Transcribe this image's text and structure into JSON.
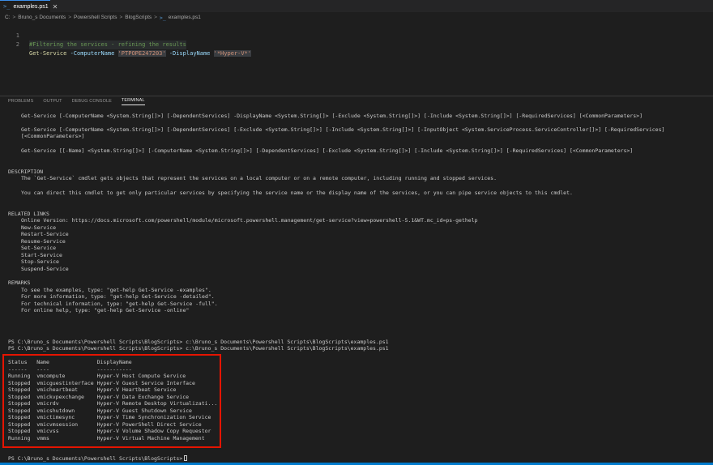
{
  "tab": {
    "icon": "powershell-icon",
    "title": "examples.ps1",
    "close": "✕"
  },
  "breadcrumb": {
    "items": [
      "C:",
      "Bruno_s Documents",
      "Powershell Scripts",
      "BlogScripts"
    ],
    "separator": ">",
    "file_icon": "powershell-icon",
    "file": "examples.ps1"
  },
  "editor": {
    "lines": [
      {
        "num": "1",
        "text": "#Filtering the services - refining the results"
      },
      {
        "num": "2",
        "cmdlet": "Get-Service",
        "param1": "-ComputerName",
        "value1": "'PTPOPE247203'",
        "param2": "-DisplayName",
        "value2": "'*Hyper-V*'"
      }
    ]
  },
  "panel": {
    "tabs": [
      "PROBLEMS",
      "OUTPUT",
      "DEBUG CONSOLE",
      "TERMINAL"
    ],
    "active": "TERMINAL"
  },
  "terminal": {
    "syntax1": "Get-Service [-ComputerName <System.String[]>] [-DependentServices] -DisplayName <System.String[]> [-Exclude <System.String[]>] [-Include <System.String[]>] [-RequiredServices] [<CommonParameters>]",
    "syntax2a": "Get-Service [-ComputerName <System.String[]>] [-DependentServices] [-Exclude <System.String[]>] [-Include <System.String[]>] [-InputObject <System.ServiceProcess.ServiceController[]>] [-RequiredServices]",
    "syntax2b": "[<CommonParameters>]",
    "syntax3": "Get-Service [[-Name] <System.String[]>] [-ComputerName <System.String[]>] [-DependentServices] [-Exclude <System.String[]>] [-Include <System.String[]>] [-RequiredServices] [<CommonParameters>]",
    "description_header": "DESCRIPTION",
    "description1": "The `Get-Service` cmdlet gets objects that represent the services on a local computer or on a remote computer, including running and stopped services.",
    "description2": "You can direct this cmdlet to get only particular services by specifying the service name or the display name of the services, or you can pipe service objects to this cmdlet.",
    "related_header": "RELATED LINKS",
    "related": [
      "Online Version: https://docs.microsoft.com/powershell/module/microsoft.powershell.management/get-service?view=powershell-5.1&WT.mc_id=ps-gethelp",
      "New-Service",
      "Restart-Service",
      "Resume-Service",
      "Set-Service",
      "Start-Service",
      "Stop-Service",
      "Suspend-Service"
    ],
    "remarks_header": "REMARKS",
    "remarks": [
      "To see the examples, type: \"get-help Get-Service -examples\".",
      "For more information, type: \"get-help Get-Service -detailed\".",
      "For technical information, type: \"get-help Get-Service -full\".",
      "For online help, type: \"get-help Get-Service -online\""
    ],
    "prompt_lines": [
      "PS C:\\Bruno_s Documents\\Powershell Scripts\\BlogScripts> c:\\Bruno_s Documents\\Powershell Scripts\\BlogScripts\\examples.ps1",
      "PS C:\\Bruno_s Documents\\Powershell Scripts\\BlogScripts> c:\\Bruno_s Documents\\Powershell Scripts\\BlogScripts\\examples.ps1"
    ],
    "table": {
      "header": "Status   Name               DisplayName",
      "underline": "------   ----               -----------",
      "rows": [
        "Running  vmcompute          Hyper-V Host Compute Service",
        "Stopped  vmicguestinterface Hyper-V Guest Service Interface",
        "Stopped  vmicheartbeat      Hyper-V Heartbeat Service",
        "Stopped  vmickvpexchange    Hyper-V Data Exchange Service",
        "Stopped  vmicrdv            Hyper-V Remote Desktop Virtualizati...",
        "Stopped  vmicshutdown       Hyper-V Guest Shutdown Service",
        "Stopped  vmictimesync       Hyper-V Time Synchronization Service",
        "Stopped  vmicvmsession      Hyper-V PowerShell Direct Service",
        "Stopped  vmicvss            Hyper-V Volume Shadow Copy Requestor",
        "Running  vmms               Hyper-V Virtual Machine Management"
      ]
    },
    "final_prompt": "PS C:\\Bruno_s Documents\\Powershell Scripts\\BlogScripts>"
  },
  "colors": {
    "accent": "#007acc",
    "highlight_box": "#e51400"
  }
}
